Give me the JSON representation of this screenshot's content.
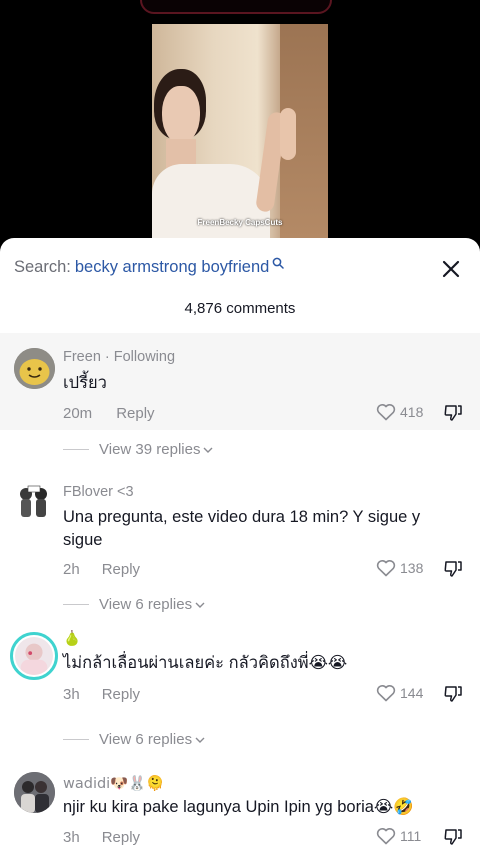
{
  "video": {
    "watermark": "FreenBecky CapsCuts"
  },
  "search": {
    "prefix": "Search:",
    "query": "becky armstrong boyfriend"
  },
  "comments_count": "4,876 comments",
  "comments": [
    {
      "username": "Freen · Following",
      "text": "เปรี้ยว",
      "time": "20m",
      "reply_label": "Reply",
      "likes": "418",
      "view_replies": "View 39 replies",
      "avatar_icon": "smiling-face-icon"
    },
    {
      "username": "FBlover <3",
      "text": "Una pregunta, este video dura 18 min? Y sigue y sigue",
      "time": "2h",
      "reply_label": "Reply",
      "likes": "138",
      "view_replies": "View 6 replies",
      "avatar_icon": "two-girls-sketch-icon"
    },
    {
      "username": "🍐",
      "text": "ไม่กล้าเลื่อนผ่านเลยค่ะ กลัวคิดถึงพี่😭😭",
      "time": "3h",
      "reply_label": "Reply",
      "likes": "144",
      "view_replies": "View 6 replies",
      "avatar_icon": "profile-photo-icon"
    },
    {
      "username": "wadidi🐶🐰🫠",
      "text": "njir ku kira pake lagunya Upin Ipin yg boria😭🤣",
      "time": "3h",
      "reply_label": "Reply",
      "likes": "111",
      "avatar_icon": "couple-photo-icon"
    }
  ],
  "colors": {
    "query": "#2c58a5",
    "muted": "#8a8b91",
    "highlight_bg": "#f6f6f6",
    "avatar_ring": "#3fd3cf"
  }
}
